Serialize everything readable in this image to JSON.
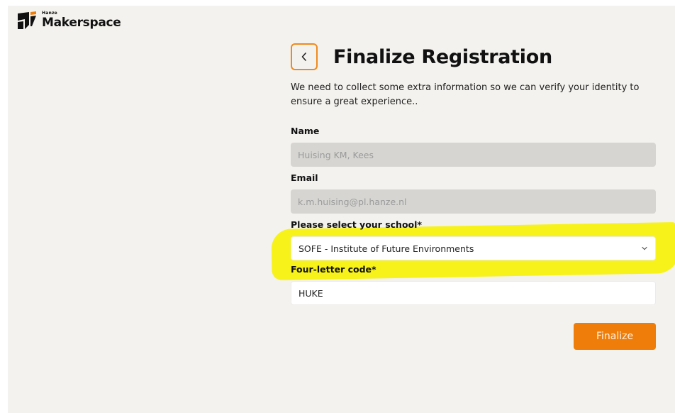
{
  "brand": {
    "small": "Hanze",
    "name": "Makerspace"
  },
  "header": {
    "title": "Finalize Registration"
  },
  "description": "We need to collect some extra information so we can verify your identity to ensure a great experience..",
  "form": {
    "name": {
      "label": "Name",
      "value": "Huising KM, Kees"
    },
    "email": {
      "label": "Email",
      "value": "k.m.huising@pl.hanze.nl"
    },
    "school": {
      "label": "Please select your school*",
      "value": "SOFE - Institute of Future Environments"
    },
    "code": {
      "label": "Four-letter code*",
      "value": "HUKE"
    }
  },
  "actions": {
    "finalize": "Finalize"
  },
  "colors": {
    "accent": "#ef7d0a",
    "highlight": "#f6f21a",
    "background": "#f4f2ee"
  },
  "icons": {
    "back": "chevron-left-icon",
    "dropdown": "chevron-down-icon"
  }
}
